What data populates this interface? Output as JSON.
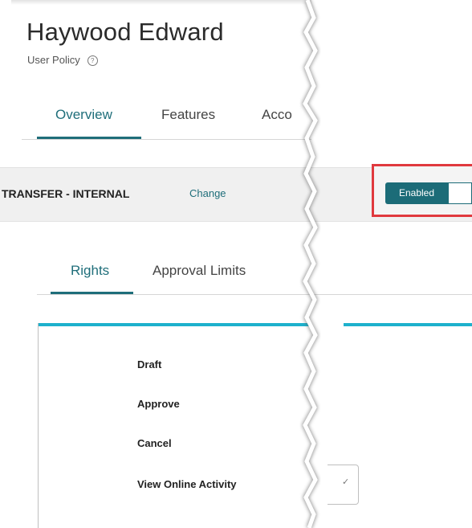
{
  "header": {
    "title": "Haywood Edward",
    "subtitle": "User Policy",
    "help_icon": "?"
  },
  "tabs": [
    {
      "label": "Overview",
      "active": true
    },
    {
      "label": "Features"
    },
    {
      "label": "Acco"
    }
  ],
  "section": {
    "title": "TRANSFER - INTERNAL",
    "change_label": "Change"
  },
  "toggle": {
    "label": "Enabled",
    "state": "on"
  },
  "subtabs": [
    {
      "label": "Rights",
      "active": true
    },
    {
      "label": "Approval Limits"
    }
  ],
  "rights": [
    "Draft",
    "Approve",
    "Cancel",
    "View Online Activity"
  ],
  "colors": {
    "accent": "#1f6e7a",
    "toggle": "#1c6c78",
    "highlight": "#e0393e",
    "bar": "#1eb1cc"
  }
}
